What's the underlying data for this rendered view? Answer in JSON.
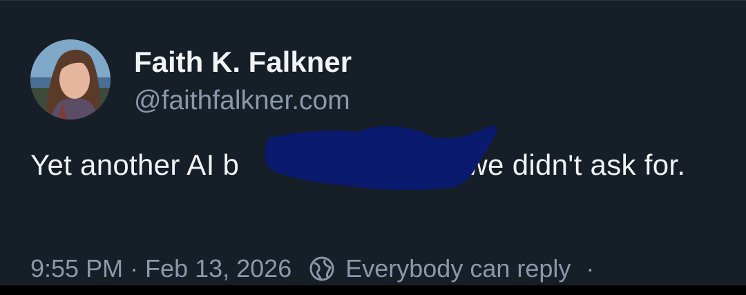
{
  "post": {
    "author_name": "Faith K. Falkner",
    "author_handle": "@faithfalkner.com",
    "text_before": "Yet another AI b",
    "text_after": "al we didn't ask for.",
    "time_date": "9:55 PM · Feb 13, 2026",
    "reply_setting": "Everybody can reply",
    "trailing_dot": "·"
  },
  "icons": {
    "avatar": "profile-photo",
    "reply_icon": "globe-icon"
  },
  "colors": {
    "background": "#161e27",
    "primary_text": "#f1f3f5",
    "secondary_text": "#8b98a9",
    "redaction": "#0a1a6e"
  }
}
